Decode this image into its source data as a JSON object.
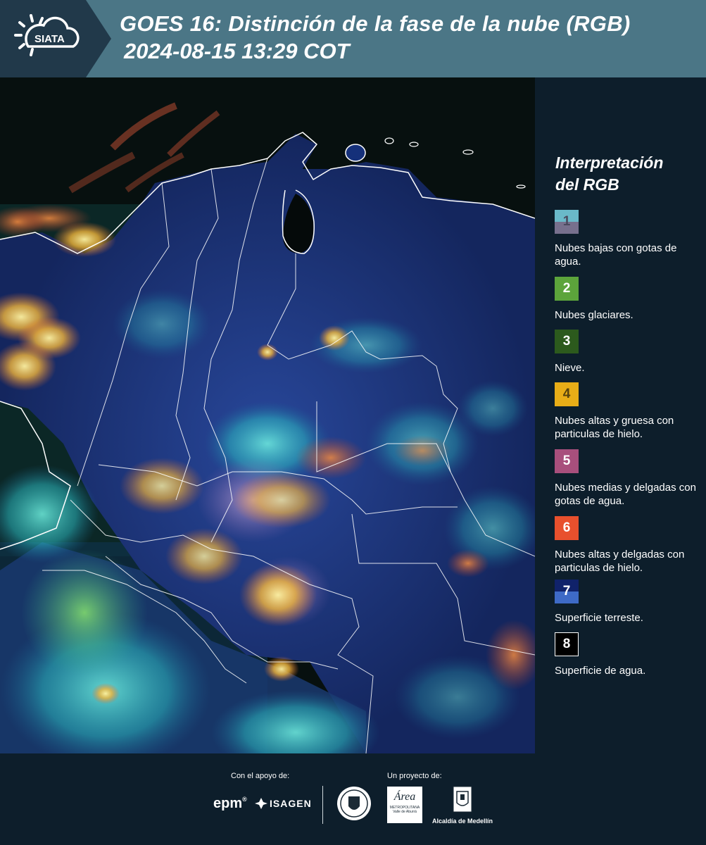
{
  "header": {
    "logo_text": "SIATA",
    "title_line1": "GOES 16: Distinción de la fase de la nube (RGB)",
    "title_line2": "2024-08-15 13:29 COT"
  },
  "legend": {
    "title_line1": "Interpretación",
    "title_line2": "del RGB",
    "items": [
      {
        "number": "1",
        "label": "Nubes bajas con gotas de agua.",
        "color_top": "#6ab9c9",
        "color_bottom": "#77708d",
        "text_color": "#4a4a5e"
      },
      {
        "number": "2",
        "label": "Nubes glaciares.",
        "color_top": "#5ca43b",
        "color_bottom": "#5ca43b",
        "text_color": "#ffffff"
      },
      {
        "number": "3",
        "label": "Nieve.",
        "color_top": "#2c5a1d",
        "color_bottom": "#2c5a1d",
        "text_color": "#ffffff"
      },
      {
        "number": "4",
        "label": "Nubes altas y gruesa con particulas de hielo.",
        "color_top": "#e8ad17",
        "color_bottom": "#e8ad17",
        "text_color": "#55420e"
      },
      {
        "number": "5",
        "label": "Nubes medias y delgadas con gotas de agua.",
        "color_top": "#a84f7c",
        "color_bottom": "#a84f7c",
        "text_color": "#ffffff"
      },
      {
        "number": "6",
        "label": "Nubes altas y delgadas con particulas de hielo.",
        "color_top": "#e8502d",
        "color_bottom": "#e8502d",
        "text_color": "#ffffff"
      },
      {
        "number": "7",
        "label": "Superficie terreste.",
        "color_top": "#10226a",
        "color_bottom": "#3e6ac6",
        "text_color": "#ffffff"
      },
      {
        "number": "8",
        "label": "Superficie de agua.",
        "color_top": "#000000",
        "color_bottom": "#000000",
        "text_color": "#ffffff"
      }
    ]
  },
  "footer": {
    "support_caption": "Con el apoyo de:",
    "project_caption": "Un proyecto de:",
    "epm_text": "epm",
    "isagen_text": "ISAGEN",
    "area_text": "Área",
    "area_sub1": "METROPOLITANA",
    "area_sub2": "Valle de Aburrá",
    "alcaldia_text": "Alcaldía de Medellín"
  }
}
